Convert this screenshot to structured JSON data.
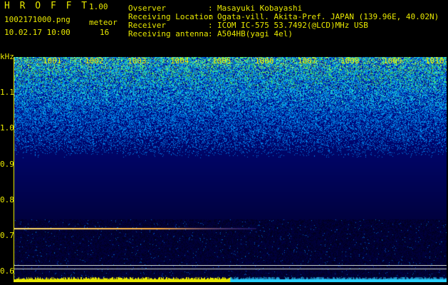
{
  "header": {
    "app_title": "H R O F F T",
    "version": "1.00",
    "filename": "1002171000.png",
    "datetime": "10.02.17 10:00",
    "meteor_label": "meteor",
    "meteor_count": "16",
    "info": [
      {
        "key": "Ovserver",
        "value": "Masayuki Kobayashi"
      },
      {
        "key": "Receiving Location",
        "value": "Ogata-vill. Akita-Pref. JAPAN (139.96E, 40.02N)"
      },
      {
        "key": "Receiver",
        "value": "ICOM IC-575 53.7492(@LCD)MHz USB"
      },
      {
        "key": "Receiving antenna",
        "value": "A504HB(yagi 4el)"
      }
    ]
  },
  "axis": {
    "unit": "kHz",
    "minute_labels": [
      "1001",
      "1002",
      "1003",
      "1004",
      "1005",
      "1006",
      "1007",
      "1008",
      "1009",
      "1010"
    ],
    "freq_labels": [
      "1.1",
      "1.0",
      "0.9",
      "0.8",
      "0.7",
      "0.6"
    ]
  },
  "colors": {
    "text": "#e8e800",
    "accent_green": "#4fd34f",
    "signal_strong": "#e8e800",
    "signal_weak": "#2ad0ff"
  },
  "chart_data": {
    "type": "heatmap",
    "x_range_minutes": [
      1000,
      1010
    ],
    "y_range_khz": [
      0.59,
      1.19
    ],
    "meteor_trace_khz": 0.735,
    "meteor_trace_minutes": [
      1000,
      1005.6
    ],
    "ref_lines_khz": [
      0.605,
      0.615
    ],
    "bottom_level": [
      {
        "minutes": [
          1000,
          1005
        ],
        "color": "#e8e800"
      },
      {
        "minutes": [
          1005,
          1010
        ],
        "color": "#2ad0ff"
      }
    ]
  }
}
